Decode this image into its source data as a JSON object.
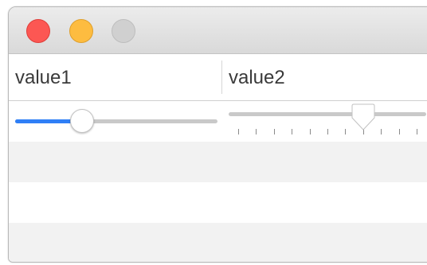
{
  "window": {
    "controls": [
      "close",
      "minimize",
      "zoom"
    ]
  },
  "table": {
    "columns": [
      "value1",
      "value2"
    ],
    "rows": [
      {
        "value1": {
          "type": "slider",
          "value": 0.33
        },
        "value2": {
          "type": "ticked-slider",
          "value": 0.68,
          "tick_marks": 11
        }
      },
      {},
      {},
      {}
    ]
  },
  "colors": {
    "accent": "#2f7ff6",
    "close": "#fc5753",
    "minimize": "#fdbc40",
    "zoom_inactive": "#d0d0d0",
    "alt_row": "#f2f2f2"
  }
}
